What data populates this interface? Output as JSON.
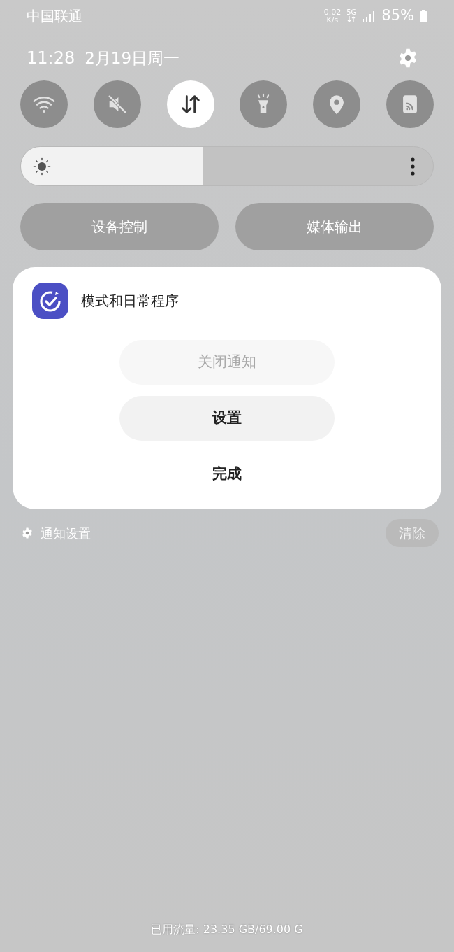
{
  "status_bar": {
    "carrier": "中国联通",
    "speed_value": "0.02",
    "speed_unit": "K/s",
    "network": "5G",
    "battery": "85%"
  },
  "header": {
    "time": "11:28",
    "date": "2月19日周一"
  },
  "toggles": [
    {
      "kind": "wifi",
      "on": false
    },
    {
      "kind": "mute",
      "on": false
    },
    {
      "kind": "data",
      "on": true
    },
    {
      "kind": "flashlight",
      "on": false
    },
    {
      "kind": "location",
      "on": false
    },
    {
      "kind": "cast",
      "on": false
    }
  ],
  "brightness": {
    "level": 0.44
  },
  "quick_buttons": [
    "设备控制",
    "媒体输出"
  ],
  "notification": {
    "app": "模式和日常程序",
    "actions": [
      {
        "label": "关闭通知",
        "kind": "pill",
        "disabled": true
      },
      {
        "label": "设置",
        "kind": "pill",
        "disabled": false
      },
      {
        "label": "完成",
        "kind": "plain",
        "disabled": false
      }
    ]
  },
  "footer": {
    "settings": "通知设置",
    "clear": "清除",
    "clear_disabled": true
  },
  "data_usage": "已用流量: 23.35 GB/69.00 G"
}
